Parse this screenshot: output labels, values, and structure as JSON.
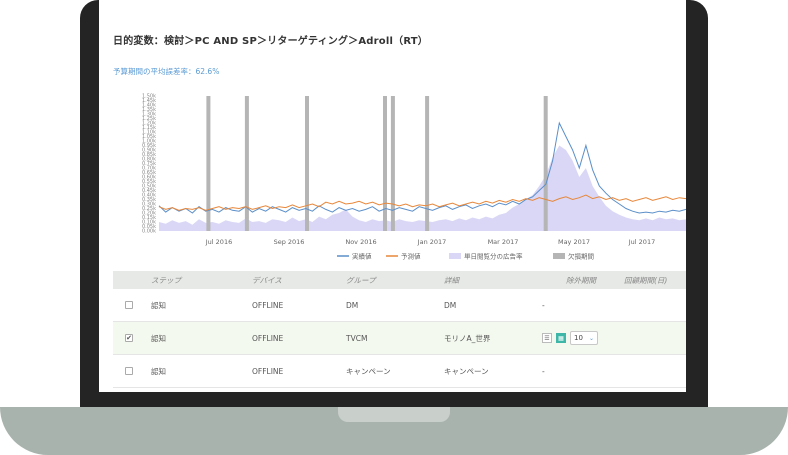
{
  "page": {
    "title": "日的変数：検討＞PC AND SP＞リターゲティング＞Adroll（RT）",
    "subtitle": "予算期間の平均誤差率：62.6%"
  },
  "chart_data": {
    "type": "line",
    "x_labels": [
      "Jul 2016",
      "Sep 2016",
      "Nov 2016",
      "Jan 2017",
      "Mar 2017",
      "May 2017",
      "Jul 2017"
    ],
    "y_labels": [
      "0.00k",
      "0.05k",
      "0.10k",
      "0.15k",
      "0.20k",
      "0.25k",
      "0.30k",
      "0.35k",
      "0.40k",
      "0.45k",
      "0.50k",
      "0.55k",
      "0.60k",
      "0.65k",
      "0.70k",
      "0.75k",
      "0.80k",
      "0.85k",
      "0.90k",
      "0.95k",
      "1.00k",
      "1.05k",
      "1.10k",
      "1.15k",
      "1.20k",
      "1.25k",
      "1.30k",
      "1.35k",
      "1.40k",
      "1.45k",
      "1.50k"
    ],
    "ylim": [
      0,
      1.5
    ],
    "series": [
      {
        "name": "実績値",
        "color": "#5b8fc9",
        "values": [
          0.28,
          0.21,
          0.26,
          0.22,
          0.25,
          0.2,
          0.27,
          0.22,
          0.24,
          0.21,
          0.26,
          0.23,
          0.22,
          0.27,
          0.21,
          0.25,
          0.22,
          0.27,
          0.24,
          0.21,
          0.26,
          0.23,
          0.25,
          0.22,
          0.28,
          0.24,
          0.21,
          0.26,
          0.23,
          0.25,
          0.22,
          0.24,
          0.27,
          0.22,
          0.25,
          0.23,
          0.26,
          0.24,
          0.22,
          0.27,
          0.25,
          0.23,
          0.26,
          0.28,
          0.24,
          0.27,
          0.29,
          0.25,
          0.28,
          0.3,
          0.27,
          0.31,
          0.29,
          0.33,
          0.3,
          0.35,
          0.38,
          0.45,
          0.52,
          0.78,
          1.2,
          1.05,
          0.9,
          0.7,
          0.95,
          0.68,
          0.5,
          0.42,
          0.35,
          0.3,
          0.25,
          0.22,
          0.2,
          0.21,
          0.2,
          0.22,
          0.21,
          0.23,
          0.22,
          0.24
        ]
      },
      {
        "name": "予測値",
        "color": "#e8873a",
        "values": [
          0.27,
          0.24,
          0.26,
          0.23,
          0.25,
          0.24,
          0.26,
          0.23,
          0.25,
          0.27,
          0.24,
          0.26,
          0.25,
          0.27,
          0.24,
          0.26,
          0.28,
          0.25,
          0.27,
          0.26,
          0.29,
          0.26,
          0.28,
          0.3,
          0.27,
          0.32,
          0.3,
          0.33,
          0.3,
          0.31,
          0.33,
          0.3,
          0.32,
          0.29,
          0.31,
          0.3,
          0.28,
          0.3,
          0.27,
          0.29,
          0.28,
          0.3,
          0.27,
          0.29,
          0.31,
          0.28,
          0.3,
          0.32,
          0.3,
          0.33,
          0.31,
          0.34,
          0.32,
          0.35,
          0.33,
          0.36,
          0.34,
          0.37,
          0.35,
          0.33,
          0.36,
          0.38,
          0.35,
          0.37,
          0.4,
          0.36,
          0.38,
          0.35,
          0.37,
          0.34,
          0.36,
          0.33,
          0.35,
          0.37,
          0.34,
          0.36,
          0.38,
          0.35,
          0.37,
          0.36
        ]
      },
      {
        "name": "単日閲覧分の広告率",
        "color": "#d9d7f5",
        "kind": "area",
        "values": [
          0.1,
          0.08,
          0.12,
          0.09,
          0.11,
          0.07,
          0.13,
          0.09,
          0.1,
          0.08,
          0.12,
          0.1,
          0.09,
          0.14,
          0.1,
          0.11,
          0.09,
          0.13,
          0.12,
          0.1,
          0.15,
          0.11,
          0.13,
          0.1,
          0.16,
          0.13,
          0.18,
          0.2,
          0.24,
          0.16,
          0.12,
          0.1,
          0.13,
          0.11,
          0.12,
          0.1,
          0.13,
          0.11,
          0.1,
          0.12,
          0.11,
          0.1,
          0.12,
          0.13,
          0.11,
          0.14,
          0.12,
          0.15,
          0.13,
          0.16,
          0.14,
          0.18,
          0.2,
          0.26,
          0.3,
          0.35,
          0.4,
          0.5,
          0.62,
          0.82,
          0.95,
          0.9,
          0.78,
          0.6,
          0.7,
          0.5,
          0.38,
          0.28,
          0.22,
          0.18,
          0.15,
          0.13,
          0.12,
          0.14,
          0.12,
          0.15,
          0.13,
          0.14,
          0.12,
          0.13
        ]
      },
      {
        "name": "欠損期間",
        "color": "#b5b5b5",
        "kind": "bands",
        "positions": [
          0.09,
          0.163,
          0.277,
          0.425,
          0.44,
          0.505,
          0.73
        ]
      }
    ],
    "legend": [
      "実績値",
      "予測値",
      "単日閲覧分の広告率",
      "欠損期間"
    ]
  },
  "table": {
    "headers": [
      "ステップ",
      "デバイス",
      "グループ",
      "詳細",
      "除外期間",
      "回顧期間(日)"
    ],
    "rows": [
      {
        "checked": false,
        "step": "認知",
        "device": "OFFLINE",
        "group": "DM",
        "detail": "DM",
        "exclusion": "-",
        "lookback": ""
      },
      {
        "checked": true,
        "step": "認知",
        "device": "OFFLINE",
        "group": "TVCM",
        "detail": "モリノA_世界",
        "exclusion": "",
        "dropdown": "10",
        "lookback": ""
      },
      {
        "checked": false,
        "step": "認知",
        "device": "OFFLINE",
        "group": "キャンペーン",
        "detail": "キャンペーン",
        "exclusion": "-",
        "lookback": ""
      }
    ]
  },
  "icons": {
    "check_glyph": "✔",
    "list_glyph": "☰",
    "grid_glyph": "▦",
    "chevron_glyph": "⌄"
  }
}
